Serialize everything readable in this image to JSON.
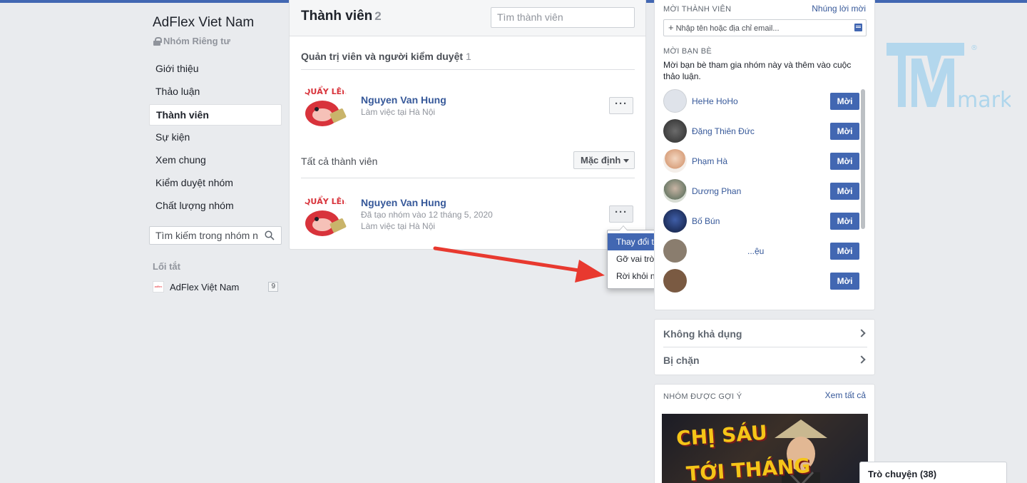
{
  "group": {
    "name": "AdFlex Viet Nam",
    "privacy": "Nhóm Riêng tư"
  },
  "nav": {
    "items": [
      {
        "label": "Giới thiệu"
      },
      {
        "label": "Thảo luận"
      },
      {
        "label": "Thành viên",
        "active": true
      },
      {
        "label": "Sự kiện"
      },
      {
        "label": "Xem chung"
      },
      {
        "label": "Kiểm duyệt nhóm"
      },
      {
        "label": "Chất lượng nhóm"
      }
    ],
    "search_value": "Tìm kiếm trong nhóm n",
    "shortcuts_label": "Lối tắt",
    "shortcut": {
      "label": "AdFlex Việt Nam",
      "count": "9"
    }
  },
  "members": {
    "title": "Thành viên",
    "count": "2",
    "search_placeholder": "Tìm thành viên",
    "admins_title": "Quản trị viên và người kiểm duyệt",
    "admins_count": "1",
    "admin": {
      "name": "Nguyen Van Hung",
      "sub1": "Làm việc tại Hà Nội"
    },
    "all_title": "Tất cả thành viên",
    "sort_label": "Mặc định",
    "member": {
      "name": "Nguyen Van Hung",
      "sub1": "Đã tạo nhóm vào 12 tháng 5, 2020",
      "sub2": "Làm việc tại Hà Nội"
    },
    "avatar_text": "QUẨY LÊN!!",
    "more_label": "···"
  },
  "context_menu": {
    "items": [
      {
        "label": "Thay đổi thành người kiểm duyệt",
        "highlighted": true
      },
      {
        "label": "Gỡ vai trò quản trị viên"
      },
      {
        "label": "Rời khỏi nhóm"
      }
    ]
  },
  "invite": {
    "members_caption": "MỜI THÀNH VIÊN",
    "embed_link": "Nhúng lời mời",
    "input_placeholder": "Nhập tên hoặc địa chỉ email...",
    "friends_caption": "MỜI BẠN BÈ",
    "friends_desc": "Mời bạn bè tham gia nhóm này và thêm vào cuộc thảo luận.",
    "button_label": "Mời",
    "friends": [
      {
        "name": "HeHe HoHo"
      },
      {
        "name": "Đặng Thiên Đức"
      },
      {
        "name": "Phạm Hà"
      },
      {
        "name": "Dương Phan"
      },
      {
        "name": "Bố Bún"
      },
      {
        "name": "...ệu"
      },
      {
        "name": ""
      }
    ]
  },
  "availability": {
    "unavailable": "Không khả dụng",
    "blocked": "Bị chặn"
  },
  "suggested": {
    "caption": "NHÓM ĐƯỢC GỢI Ý",
    "see_all": "Xem tất cả",
    "image_text_1": "CHỊ SÁU",
    "image_text_2": "TỚI THÁNG"
  },
  "chat": {
    "label": "Trò chuyện (38)"
  },
  "watermark": {
    "text": "mark",
    "registered": "®"
  },
  "colors": {
    "brand": "#4267b2",
    "link": "#365899",
    "arrow": "#e8392f"
  }
}
